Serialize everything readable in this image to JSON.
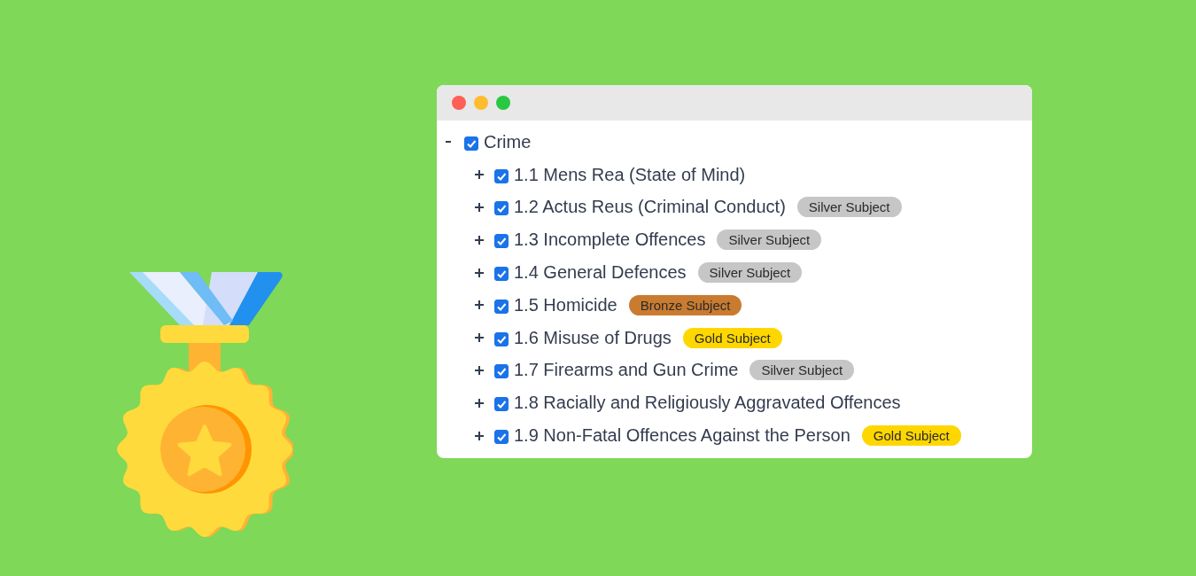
{
  "window": {
    "controls": [
      {
        "color": "#fe5f57"
      },
      {
        "color": "#febc2e"
      },
      {
        "color": "#28c840"
      }
    ]
  },
  "tree": [
    {
      "label": "Crime",
      "checked": true,
      "expanded": true,
      "children": [
        {
          "label": "1.1 Mens Rea (State of Mind)",
          "checked": true,
          "expanded": false
        },
        {
          "label": "1.2 Actus Reus (Criminal Conduct)",
          "checked": true,
          "expanded": false,
          "badge": {
            "kind": "silver",
            "text": "Silver Subject"
          }
        },
        {
          "label": "1.3 Incomplete Offences",
          "checked": true,
          "expanded": false,
          "badge": {
            "kind": "silver",
            "text": "Silver Subject"
          }
        },
        {
          "label": "1.4 General Defences",
          "checked": true,
          "expanded": false,
          "badge": {
            "kind": "silver",
            "text": "Silver Subject"
          }
        },
        {
          "label": "1.5 Homicide",
          "checked": true,
          "expanded": false,
          "badge": {
            "kind": "bronze",
            "text": "Bronze Subject"
          }
        },
        {
          "label": "1.6 Misuse of Drugs",
          "checked": true,
          "expanded": false,
          "badge": {
            "kind": "gold",
            "text": "Gold Subject"
          }
        },
        {
          "label": "1.7 Firearms and Gun Crime",
          "checked": true,
          "expanded": false,
          "badge": {
            "kind": "silver",
            "text": "Silver Subject"
          }
        },
        {
          "label": "1.8 Racially and Religiously Aggravated Offences",
          "checked": true,
          "expanded": false
        },
        {
          "label": "1.9 Non-Fatal Offences Against the Person",
          "checked": true,
          "expanded": false,
          "badge": {
            "kind": "gold",
            "text": "Gold Subject"
          }
        }
      ]
    }
  ]
}
